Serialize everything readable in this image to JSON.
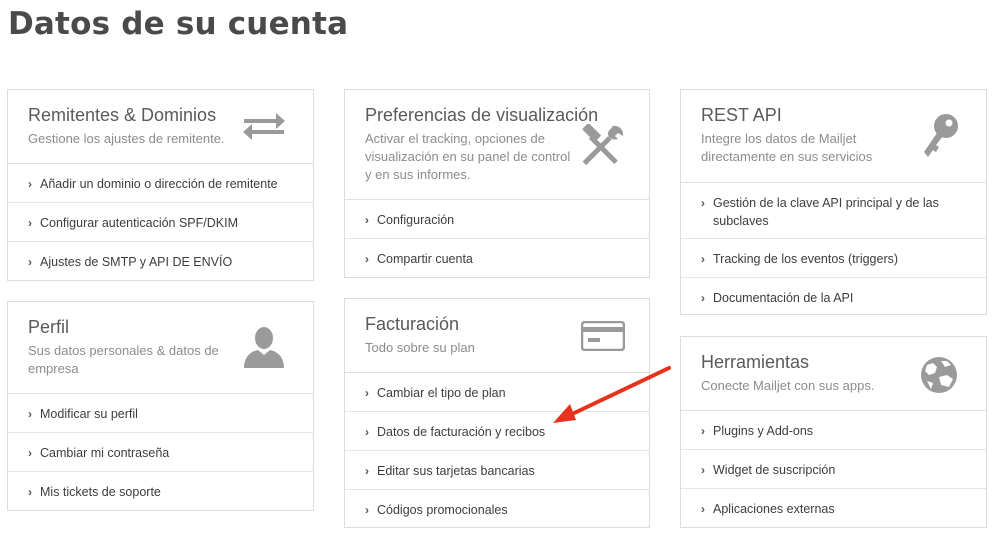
{
  "page": {
    "title": "Datos de su cuenta"
  },
  "cards": {
    "senders": {
      "title": "Remitentes & Dominios",
      "description": "Gestione los ajustes de remitente.",
      "icon": "swap-arrows-icon",
      "links": [
        "Añadir un dominio o dirección de remitente",
        "Configurar autenticación SPF/DKIM",
        "Ajustes de SMTP y API DE ENVÍO"
      ]
    },
    "profile": {
      "title": "Perfil",
      "description": "Sus datos personales & datos de empresa",
      "icon": "user-icon",
      "links": [
        "Modificar su perfil",
        "Cambiar mi contraseña",
        "Mis tickets de soporte"
      ]
    },
    "display": {
      "title": "Preferencias de visualización",
      "description": "Activar el tracking, opciones de visualización en su panel de control y en sus informes.",
      "icon": "hammer-wrench-icon",
      "links": [
        "Configuración",
        "Compartir cuenta"
      ]
    },
    "billing": {
      "title": "Facturación",
      "description": "Todo sobre su plan",
      "icon": "credit-card-icon",
      "links": [
        "Cambiar el tipo de plan",
        "Datos de facturación y recibos",
        "Editar sus tarjetas bancarias",
        "Códigos promocionales"
      ]
    },
    "rest_api": {
      "title": "REST API",
      "description": "Integre los datos de Mailjet directamente en sus servicios",
      "icon": "key-icon",
      "links": [
        "Gestión de la clave API principal y de las subclaves",
        "Tracking de los eventos (triggers)",
        "Documentación de la API"
      ]
    },
    "tools": {
      "title": "Herramientas",
      "description": "Conecte Mailjet con sus apps.",
      "icon": "globe-icon",
      "links": [
        "Plugins y Add-ons",
        "Widget de suscripción",
        "Aplicaciones externas"
      ]
    }
  },
  "annotation": {
    "arrow_color": "#e8321e"
  },
  "colors": {
    "icon_gray": "#9a9a9a",
    "border": "#dcdcdc"
  }
}
